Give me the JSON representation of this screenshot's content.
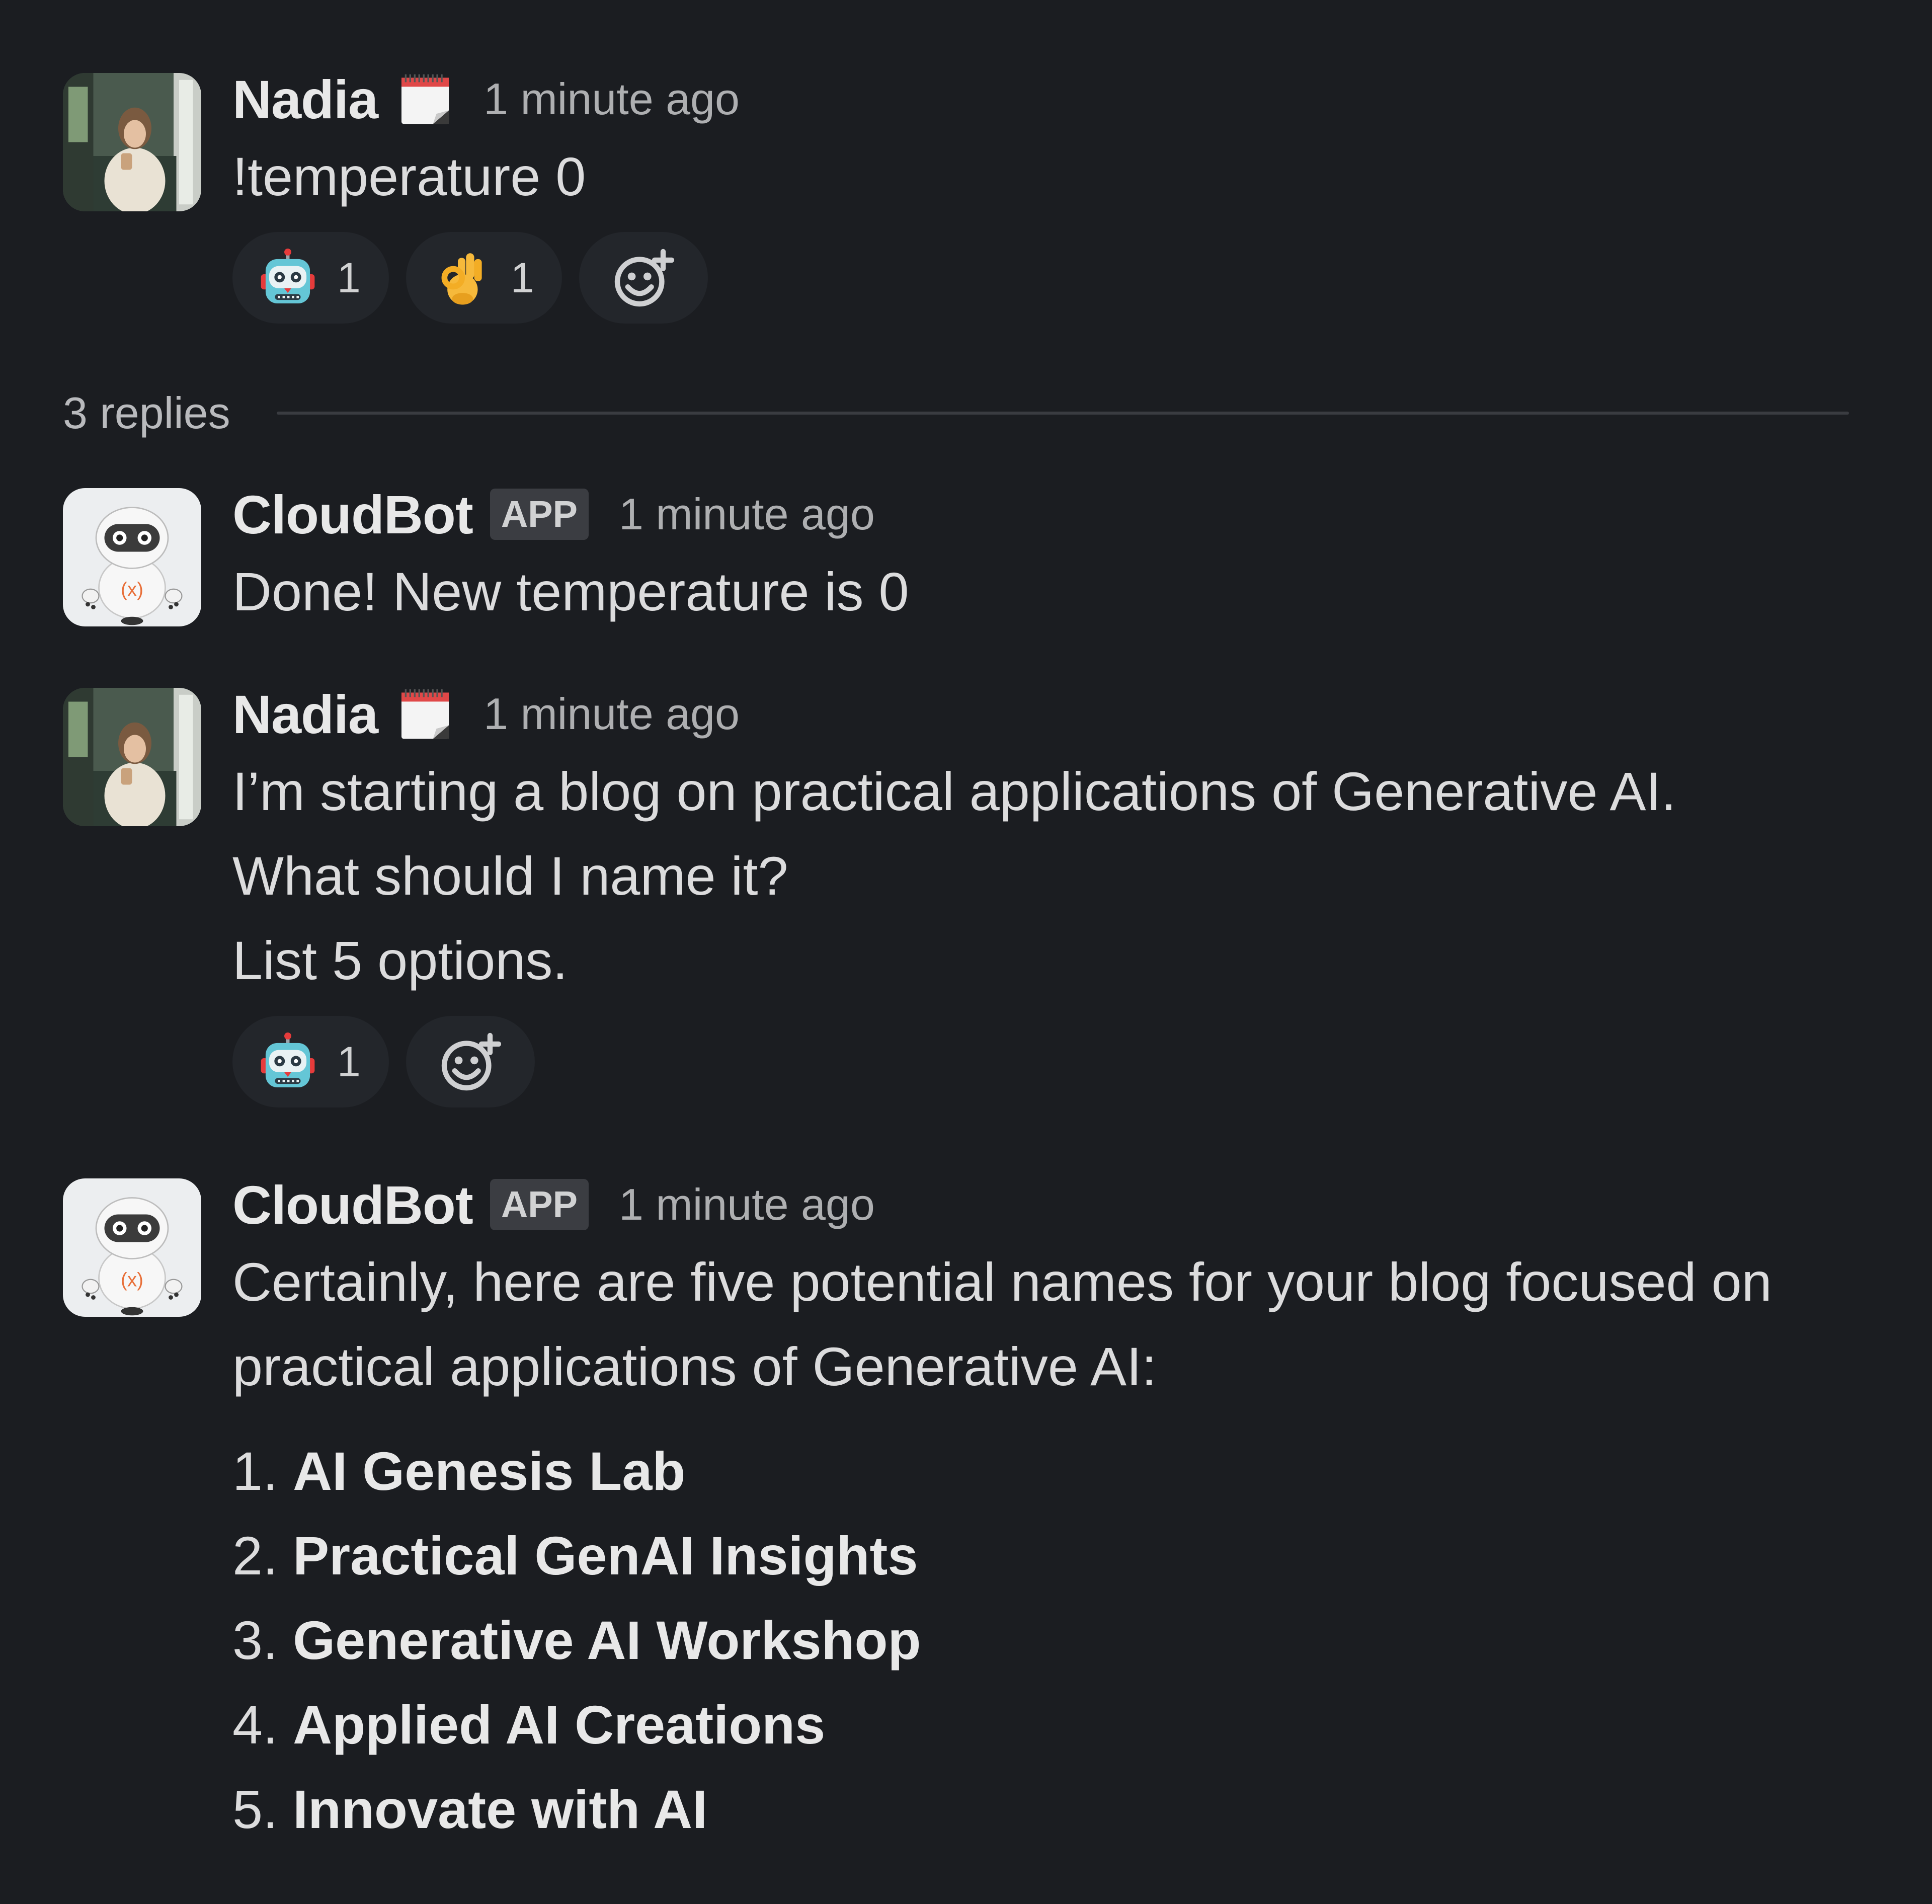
{
  "colors": {
    "background": "#1b1d21",
    "reaction_bg": "#23262b",
    "text": "#dcdcdd",
    "muted": "#aeafb1",
    "app_badge_bg": "#3b3d42"
  },
  "root_message": {
    "author": "Nadia",
    "status_icon": "spiral-calendar-icon",
    "timestamp": "1 minute ago",
    "text": "!temperature 0",
    "reactions": [
      {
        "icon": "robot-emoji",
        "count": "1"
      },
      {
        "icon": "ok-hand-emoji",
        "count": "1"
      }
    ],
    "add_reaction_icon": "add-reaction-icon"
  },
  "replies": {
    "label": "3 replies"
  },
  "reply1": {
    "author": "CloudBot",
    "badge": "APP",
    "timestamp": "1 minute ago",
    "text": "Done! New temperature is 0"
  },
  "reply2": {
    "author": "Nadia",
    "status_icon": "spiral-calendar-icon",
    "timestamp": "1 minute ago",
    "lines": [
      "I’m starting a blog on practical applications of Generative AI.",
      "What should I name it?",
      "List 5 options."
    ],
    "reactions": [
      {
        "icon": "robot-emoji",
        "count": "1"
      }
    ],
    "add_reaction_icon": "add-reaction-icon"
  },
  "reply3": {
    "author": "CloudBot",
    "badge": "APP",
    "timestamp": "1 minute ago",
    "intro_lines": [
      "Certainly, here are five potential names for your blog focused on",
      "practical applications of Generative AI:"
    ],
    "options": [
      {
        "num": "1.",
        "name": "AI Genesis Lab"
      },
      {
        "num": "2.",
        "name": "Practical GenAI Insights"
      },
      {
        "num": "3.",
        "name": "Generative AI Workshop"
      },
      {
        "num": "4.",
        "name": "Applied AI Creations"
      },
      {
        "num": "5.",
        "name": "Innovate with AI"
      }
    ]
  }
}
